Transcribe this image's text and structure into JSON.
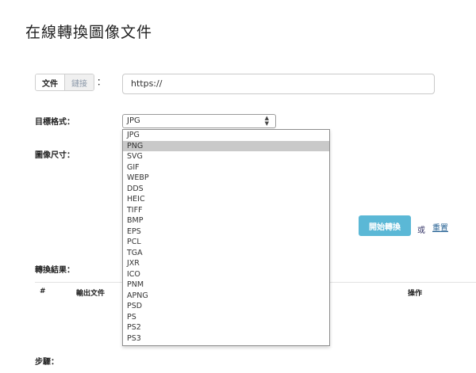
{
  "page_title": "在線轉換圖像文件",
  "source_toggle": {
    "file_label": "文件",
    "link_label": "鏈接",
    "colon": "："
  },
  "url_input": {
    "value": "https://"
  },
  "target_format": {
    "label": "目標格式：",
    "selected": "JPG",
    "options": [
      "JPG",
      "PNG",
      "SVG",
      "GIF",
      "WEBP",
      "DDS",
      "HEIC",
      "TIFF",
      "BMP",
      "EPS",
      "PCL",
      "TGA",
      "JXR",
      "ICO",
      "PNM",
      "APNG",
      "PSD",
      "PS",
      "PS2",
      "PS3"
    ],
    "highlighted": "PNG"
  },
  "image_size": {
    "label": "圖像尺寸："
  },
  "actions": {
    "convert_label": "開始轉換",
    "or_label": "或",
    "reset_label": "重置"
  },
  "results": {
    "label": "轉換結果：",
    "columns": {
      "index": "#",
      "output_file": "輸出文件",
      "actions": "操作"
    }
  },
  "steps": {
    "label": "步驟："
  }
}
